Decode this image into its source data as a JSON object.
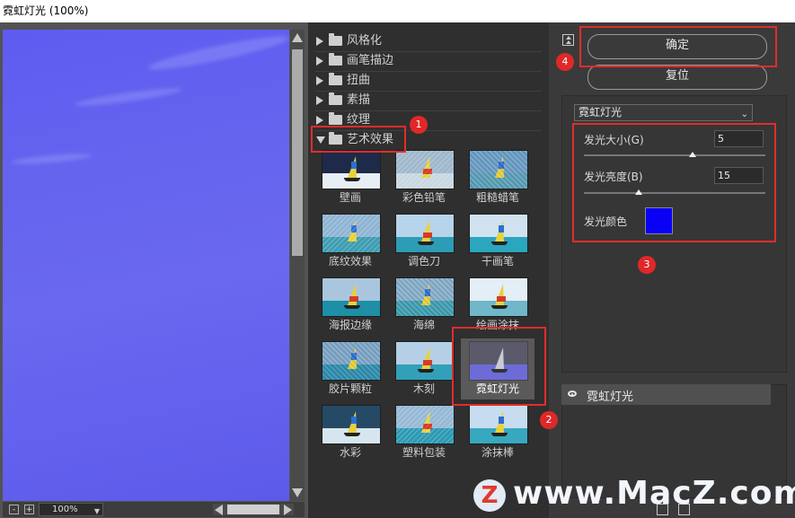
{
  "window": {
    "title": "霓虹灯光 (100%)"
  },
  "preview": {
    "zoom": "100%",
    "minus_icon": "-",
    "plus_icon": "+"
  },
  "browser": {
    "categories": [
      {
        "label": "风格化",
        "expanded": false
      },
      {
        "label": "画笔描边",
        "expanded": false
      },
      {
        "label": "扭曲",
        "expanded": false
      },
      {
        "label": "素描",
        "expanded": false
      },
      {
        "label": "纹理",
        "expanded": false
      },
      {
        "label": "艺术效果",
        "expanded": true
      }
    ],
    "filters": [
      "壁画",
      "彩色铅笔",
      "粗糙蜡笔",
      "底纹效果",
      "调色刀",
      "干画笔",
      "海报边缘",
      "海绵",
      "绘画涂抹",
      "胶片颗粒",
      "木刻",
      "霓虹灯光",
      "水彩",
      "塑料包装",
      "涂抹棒"
    ],
    "selected_filter": "霓虹灯光"
  },
  "panel": {
    "ok_label": "确定",
    "reset_label": "复位",
    "filter_select": "霓虹灯光",
    "params": {
      "glow_size_label": "发光大小(G)",
      "glow_size_value": "5",
      "glow_size_fraction": 0.6,
      "glow_brightness_label": "发光亮度(B)",
      "glow_brightness_value": "15",
      "glow_brightness_fraction": 0.3,
      "glow_color_label": "发光颜色",
      "glow_color": "#0a00f5"
    },
    "layer_name": "霓虹灯光"
  },
  "annotations": [
    "1",
    "2",
    "3",
    "4"
  ],
  "colors": {
    "annotation_red": "#e12c2c",
    "accent_blue": "#0a00f5"
  },
  "watermark": {
    "logo_letter": "Z",
    "text": "www.MacZ.com"
  }
}
